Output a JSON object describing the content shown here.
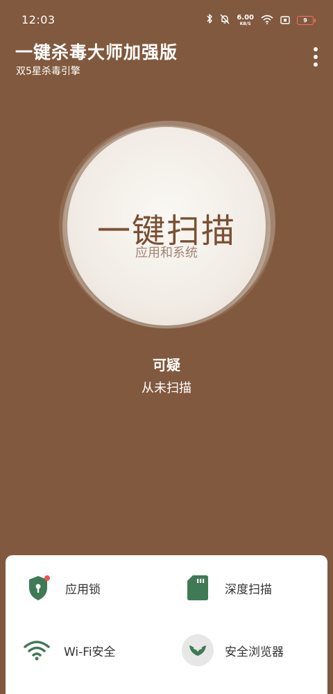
{
  "status_bar": {
    "time": "12:03",
    "net_speed_value": "6.00",
    "net_speed_unit": "KB/S",
    "battery_level": "9"
  },
  "header": {
    "title": "一键杀毒大师加强版",
    "subtitle": "双5星杀毒引擎"
  },
  "scan": {
    "title": "一键扫描",
    "subtitle": "应用和系统"
  },
  "status": {
    "label": "可疑",
    "detail": "从未扫描"
  },
  "tools": [
    {
      "label": "应用锁",
      "icon": "shield-lock-icon"
    },
    {
      "label": "深度扫描",
      "icon": "sd-card-icon"
    },
    {
      "label": "Wi-Fi安全",
      "icon": "wifi-icon"
    },
    {
      "label": "安全浏览器",
      "icon": "browser-icon"
    }
  ],
  "colors": {
    "background": "#81593e",
    "scan_title": "#7a4f33",
    "icon_green": "#3f7a55",
    "badge_red": "#f15454"
  }
}
